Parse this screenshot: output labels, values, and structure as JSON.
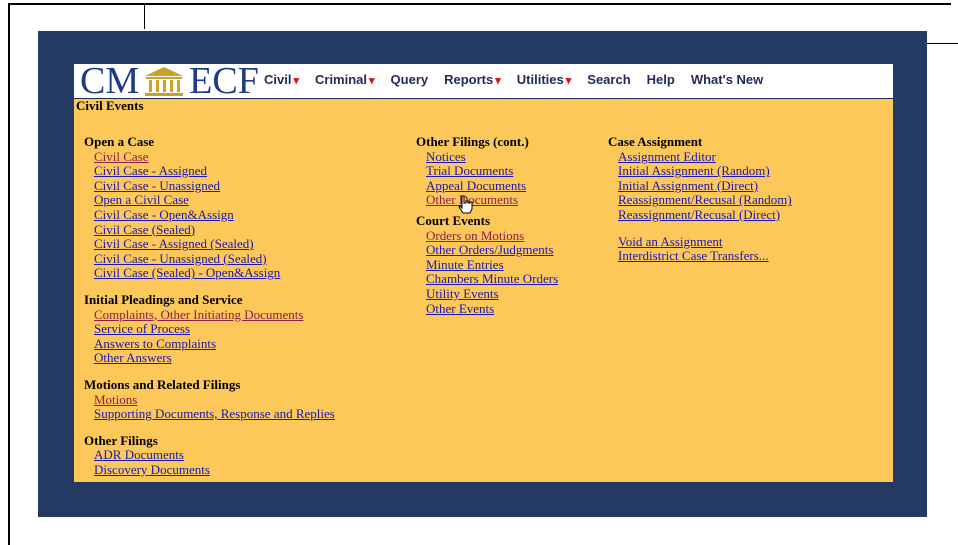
{
  "header": {
    "logo_left": "CM",
    "logo_right": "ECF",
    "menu": [
      {
        "label": "Civil",
        "caret": true
      },
      {
        "label": "Criminal",
        "caret": true
      },
      {
        "label": "Query",
        "caret": false
      },
      {
        "label": "Reports",
        "caret": true
      },
      {
        "label": "Utilities",
        "caret": true
      },
      {
        "label": "Search",
        "caret": false
      },
      {
        "label": "Help",
        "caret": false
      },
      {
        "label": "What's New",
        "caret": false
      }
    ]
  },
  "page_title": "Civil Events",
  "col1": {
    "open_case": {
      "heading": "Open a Case",
      "links": [
        "Civil Case",
        "Civil Case - Assigned",
        "Civil Case - Unassigned",
        "Open a Civil Case",
        "Civil Case - Open&Assign",
        "Civil Case (Sealed)",
        "Civil Case - Assigned (Sealed)",
        "Civil Case - Unassigned (Sealed)",
        "Civil Case (Sealed) - Open&Assign"
      ]
    },
    "initial": {
      "heading": "Initial Pleadings and Service",
      "links": [
        "Complaints, Other Initiating Documents",
        "Service of Process",
        "Answers to Complaints",
        "Other Answers"
      ]
    },
    "motions": {
      "heading": "Motions and Related Filings",
      "links": [
        "Motions",
        "Supporting Documents, Response and Replies"
      ]
    },
    "other": {
      "heading": "Other Filings",
      "links": [
        "ADR Documents",
        "Discovery Documents"
      ]
    }
  },
  "col2": {
    "other_cont": {
      "heading": "Other Filings (cont.)",
      "links": [
        "Notices",
        "Trial Documents",
        "Appeal Documents",
        "Other Documents"
      ]
    },
    "court": {
      "heading": "Court Events",
      "links": [
        "Orders on Motions",
        "Other Orders/Judgments",
        "Minute Entries",
        "Chambers Minute Orders",
        "Utility Events",
        "Other Events"
      ]
    }
  },
  "col3": {
    "assignment": {
      "heading": "Case Assignment",
      "links": [
        "Assignment Editor",
        "Initial Assignment (Random)",
        "Initial Assignment (Direct)",
        "Reassignment/Recusal (Random)",
        "Reassignment/Recusal (Direct)"
      ],
      "links2": [
        "Void an Assignment",
        "Interdistrict Case Transfers..."
      ]
    }
  },
  "colors": {
    "frame": "#243a63",
    "content_bg": "#fcc85a",
    "link": "#1a16b8",
    "visited": "#8b1d4a"
  }
}
